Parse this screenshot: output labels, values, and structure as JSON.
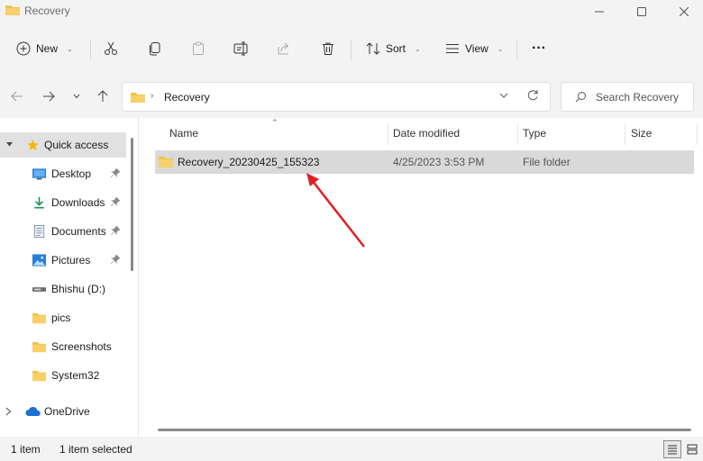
{
  "window": {
    "title": "Recovery",
    "controls": [
      "minimize-icon",
      "maximize-icon",
      "close-icon"
    ]
  },
  "toolbar": {
    "new_label": "New",
    "sort_label": "Sort",
    "view_label": "View",
    "more_label": "···"
  },
  "address": {
    "path": "Recovery",
    "separator": "›"
  },
  "search": {
    "placeholder": "Search Recovery"
  },
  "nav": {
    "quick_access": "Quick access",
    "items": [
      {
        "label": "Desktop",
        "icon": "desktop-icon",
        "pinned": true
      },
      {
        "label": "Downloads",
        "icon": "download-icon",
        "pinned": true
      },
      {
        "label": "Documents",
        "icon": "documents-icon",
        "pinned": true
      },
      {
        "label": "Pictures",
        "icon": "pictures-icon",
        "pinned": true
      },
      {
        "label": "Bhishu (D:)",
        "icon": "drive-icon",
        "pinned": false
      },
      {
        "label": "pics",
        "icon": "folder-icon",
        "pinned": false
      },
      {
        "label": "Screenshots",
        "icon": "folder-icon",
        "pinned": false
      },
      {
        "label": "System32",
        "icon": "folder-icon",
        "pinned": false
      }
    ],
    "onedrive": "OneDrive"
  },
  "columns": {
    "name": "Name",
    "date": "Date modified",
    "type": "Type",
    "size": "Size"
  },
  "files": [
    {
      "name": "Recovery_20230425_155323",
      "date": "4/25/2023 3:53 PM",
      "type": "File folder",
      "size": ""
    }
  ],
  "status": {
    "count": "1 item",
    "selected": "1 item selected"
  },
  "colors": {
    "folder": "#f0c24b",
    "selection": "#d9d9d9",
    "accent_arrow": "#e02020"
  }
}
